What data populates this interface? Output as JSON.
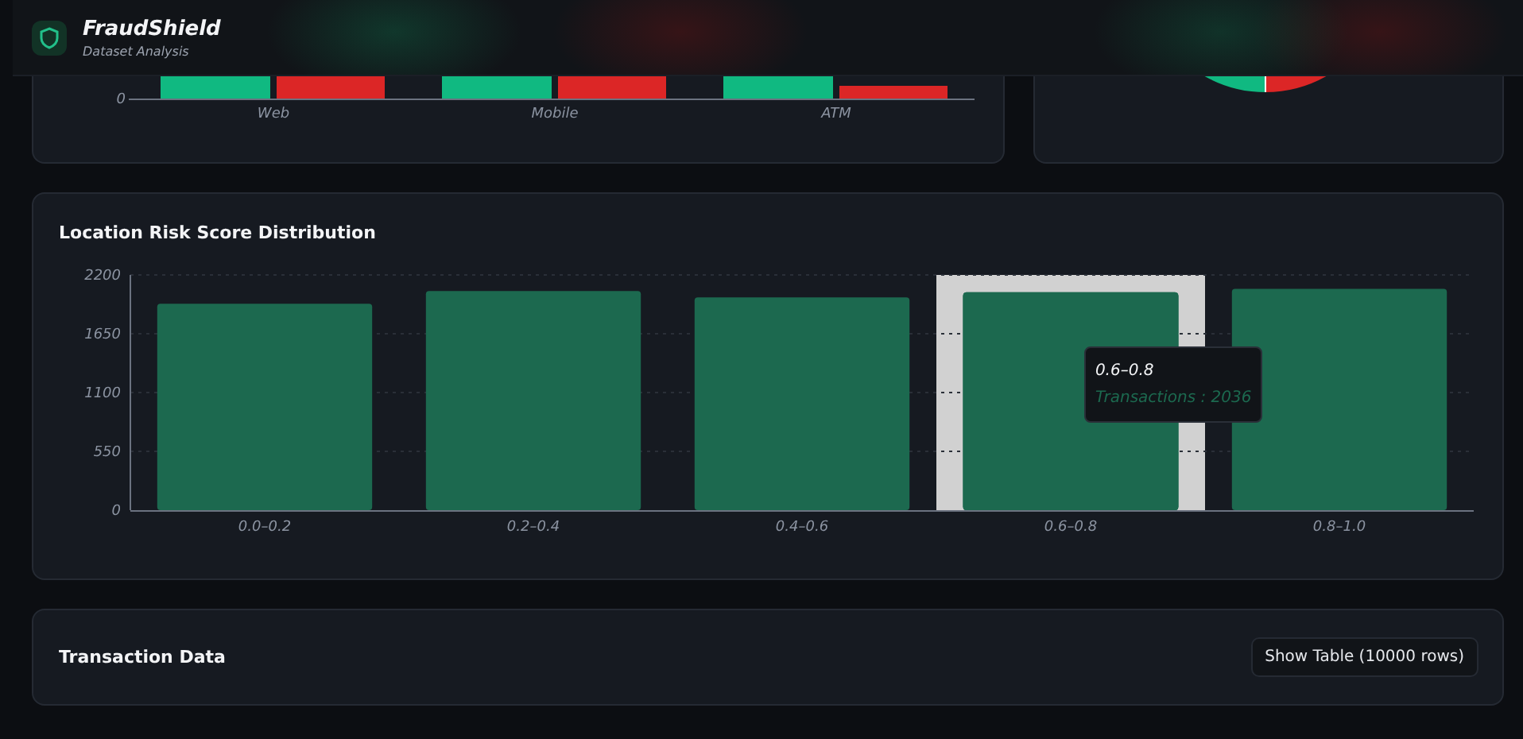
{
  "header": {
    "title": "FraudShield",
    "subtitle": "Dataset Analysis"
  },
  "channel_chart": {
    "y_tick": "0",
    "x_labels": [
      "Web",
      "Mobile",
      "ATM"
    ]
  },
  "risk_chart": {
    "title": "Location Risk Score Distribution",
    "chart_data": {
      "type": "bar",
      "categories": [
        "0.0–0.2",
        "0.2–0.4",
        "0.4–0.6",
        "0.6–0.8",
        "0.8–1.0"
      ],
      "series": [
        {
          "color": "#1c694f",
          "values": [
            1930,
            2050,
            1990,
            2036,
            2070
          ]
        }
      ],
      "ylim": [
        0,
        2200
      ],
      "yticks": [
        0,
        550,
        1100,
        1650,
        2200
      ],
      "grid": true
    },
    "bar_states": [
      {
        "hovered": false
      },
      {
        "hovered": false
      },
      {
        "hovered": false
      },
      {
        "hovered": true
      },
      {
        "hovered": false
      }
    ],
    "hover": {
      "title": "0.6–0.8",
      "line": "Transactions : 2036"
    }
  },
  "data_section": {
    "title": "Transaction Data",
    "button": "Show Table (10000 rows)"
  }
}
